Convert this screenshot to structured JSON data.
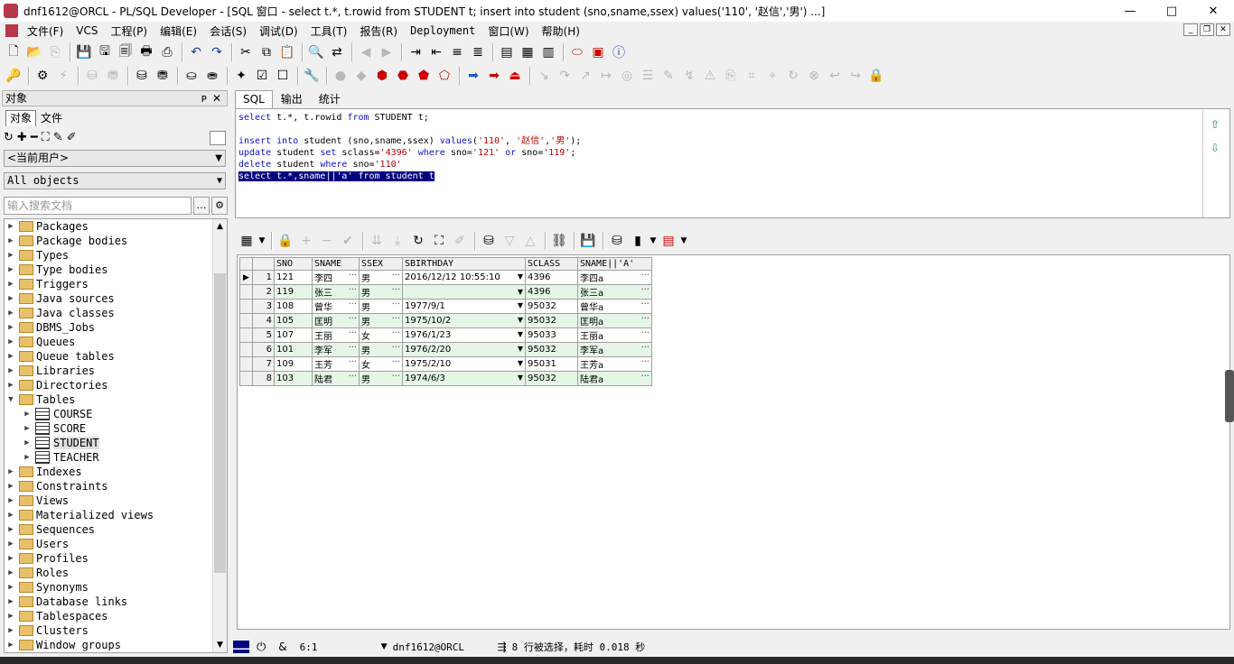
{
  "window": {
    "title": "dnf1612@ORCL - PL/SQL Developer - [SQL 窗口 - select t.*, t.rowid from STUDENT t; insert into student (sno,sname,ssex) values('110', '赵信','男') ...]",
    "min": "—",
    "max": "□",
    "close": "✕"
  },
  "menu": [
    "文件(F)",
    "VCS",
    "工程(P)",
    "编辑(E)",
    "会话(S)",
    "调试(D)",
    "工具(T)",
    "报告(R)",
    "Deployment",
    "窗口(W)",
    "帮助(H)"
  ],
  "left_panel": {
    "title": "对象",
    "pin": "ᴘ",
    "close": "✕",
    "tabs": [
      "对象",
      "文件"
    ],
    "user_combo": "<当前用户>",
    "objects_combo": "All objects",
    "search_placeholder": "输入搜索文档",
    "tree": [
      {
        "label": "Packages",
        "type": "folder"
      },
      {
        "label": "Package bodies",
        "type": "folder"
      },
      {
        "label": "Types",
        "type": "folder"
      },
      {
        "label": "Type bodies",
        "type": "folder"
      },
      {
        "label": "Triggers",
        "type": "folder"
      },
      {
        "label": "Java sources",
        "type": "folder"
      },
      {
        "label": "Java classes",
        "type": "folder"
      },
      {
        "label": "DBMS_Jobs",
        "type": "folder"
      },
      {
        "label": "Queues",
        "type": "folder"
      },
      {
        "label": "Queue tables",
        "type": "folder"
      },
      {
        "label": "Libraries",
        "type": "folder"
      },
      {
        "label": "Directories",
        "type": "folder"
      },
      {
        "label": "Tables",
        "type": "folder",
        "expanded": true
      },
      {
        "label": "COURSE",
        "type": "table"
      },
      {
        "label": "SCORE",
        "type": "table"
      },
      {
        "label": "STUDENT",
        "type": "table",
        "selected": true
      },
      {
        "label": "TEACHER",
        "type": "table"
      },
      {
        "label": "Indexes",
        "type": "folder"
      },
      {
        "label": "Constraints",
        "type": "folder"
      },
      {
        "label": "Views",
        "type": "folder"
      },
      {
        "label": "Materialized views",
        "type": "folder"
      },
      {
        "label": "Sequences",
        "type": "folder"
      },
      {
        "label": "Users",
        "type": "folder"
      },
      {
        "label": "Profiles",
        "type": "folder"
      },
      {
        "label": "Roles",
        "type": "folder"
      },
      {
        "label": "Synonyms",
        "type": "folder"
      },
      {
        "label": "Database links",
        "type": "folder"
      },
      {
        "label": "Tablespaces",
        "type": "folder"
      },
      {
        "label": "Clusters",
        "type": "folder"
      },
      {
        "label": "Window groups",
        "type": "folder"
      }
    ]
  },
  "sql_tabs": [
    "SQL",
    "输出",
    "统计"
  ],
  "editor": {
    "lines": [
      [
        [
          "kw",
          "select"
        ],
        [
          "t",
          " t.*, t.rowid "
        ],
        [
          "kw",
          "from"
        ],
        [
          "t",
          " STUDENT t;"
        ]
      ],
      [],
      [
        [
          "kw",
          "insert into"
        ],
        [
          "t",
          " student (sno,sname,ssex) "
        ],
        [
          "kw",
          "values"
        ],
        [
          "t",
          "("
        ],
        [
          "str",
          "'110'"
        ],
        [
          "t",
          ", "
        ],
        [
          "str",
          "'赵信'"
        ],
        [
          "t",
          ","
        ],
        [
          "str",
          "'男'"
        ],
        [
          "t",
          ");"
        ]
      ],
      [
        [
          "kw",
          "update"
        ],
        [
          "t",
          " student "
        ],
        [
          "kw",
          "set"
        ],
        [
          "t",
          " sclass="
        ],
        [
          "str",
          "'4396'"
        ],
        [
          "t",
          " "
        ],
        [
          "kw",
          "where"
        ],
        [
          "t",
          " sno="
        ],
        [
          "str",
          "'121'"
        ],
        [
          "t",
          " "
        ],
        [
          "kw",
          "or"
        ],
        [
          "t",
          " sno="
        ],
        [
          "str",
          "'119'"
        ],
        [
          "t",
          ";"
        ]
      ],
      [
        [
          "kw",
          "delete"
        ],
        [
          "t",
          " student "
        ],
        [
          "kw",
          "where"
        ],
        [
          "t",
          " sno="
        ],
        [
          "str",
          "'110'"
        ]
      ],
      [
        [
          "hl",
          "select t.*,sname||'a' from student t"
        ]
      ]
    ]
  },
  "grid": {
    "columns": [
      "SNO",
      "SNAME",
      "SSEX",
      "SBIRTHDAY",
      "SCLASS",
      "SNAME||'A'"
    ],
    "rows": [
      {
        "n": "1",
        "sno": "121",
        "sname": "李四",
        "ssex": "男",
        "sbirthday": "2016/12/12 10:55:10",
        "sclass": "4396",
        "expr": "李四a"
      },
      {
        "n": "2",
        "sno": "119",
        "sname": "张三",
        "ssex": "男",
        "sbirthday": "",
        "sclass": "4396",
        "expr": "张三a"
      },
      {
        "n": "3",
        "sno": "108",
        "sname": "曾华",
        "ssex": "男",
        "sbirthday": "1977/9/1",
        "sclass": "95032",
        "expr": "曾华a"
      },
      {
        "n": "4",
        "sno": "105",
        "sname": "匡明",
        "ssex": "男",
        "sbirthday": "1975/10/2",
        "sclass": "95032",
        "expr": "匡明a"
      },
      {
        "n": "5",
        "sno": "107",
        "sname": "王丽",
        "ssex": "女",
        "sbirthday": "1976/1/23",
        "sclass": "95033",
        "expr": "王丽a"
      },
      {
        "n": "6",
        "sno": "101",
        "sname": "李军",
        "ssex": "男",
        "sbirthday": "1976/2/20",
        "sclass": "95032",
        "expr": "李军a"
      },
      {
        "n": "7",
        "sno": "109",
        "sname": "王芳",
        "ssex": "女",
        "sbirthday": "1975/2/10",
        "sclass": "95031",
        "expr": "王芳a"
      },
      {
        "n": "8",
        "sno": "103",
        "sname": "陆君",
        "ssex": "男",
        "sbirthday": "1974/6/3",
        "sclass": "95032",
        "expr": "陆君a"
      }
    ]
  },
  "status": {
    "position": "6:1",
    "connection": "dnf1612@ORCL",
    "message": "8 行被选择，耗时 0.018 秒",
    "ampersand": "&"
  },
  "colors": {
    "keyword": "#1010c8",
    "string": "#b40000",
    "selection": "#000080",
    "row_alt": "#e6f6e6"
  }
}
